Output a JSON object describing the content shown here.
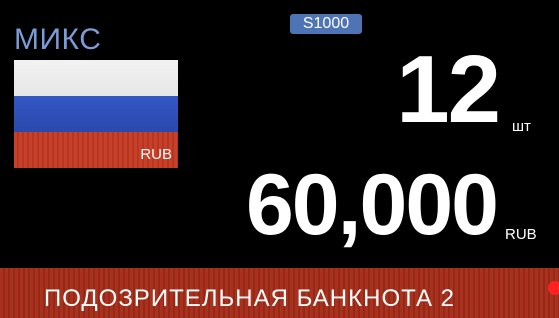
{
  "mode": "МИКС",
  "model": "S1000",
  "currency": {
    "flag_icon": "russia-flag-icon",
    "code": "RUB",
    "flag_colors": [
      "#f2f2f2",
      "#3457c4",
      "#c6402a"
    ]
  },
  "count": {
    "value": "12",
    "unit": "шт"
  },
  "amount": {
    "value": "60,000",
    "unit": "RUB"
  },
  "alert": {
    "text": "ПОДОЗРИТЕЛЬНАЯ  БАНКНОТА 2",
    "color": "#a8321d",
    "indicator_color": "#ff2020"
  }
}
